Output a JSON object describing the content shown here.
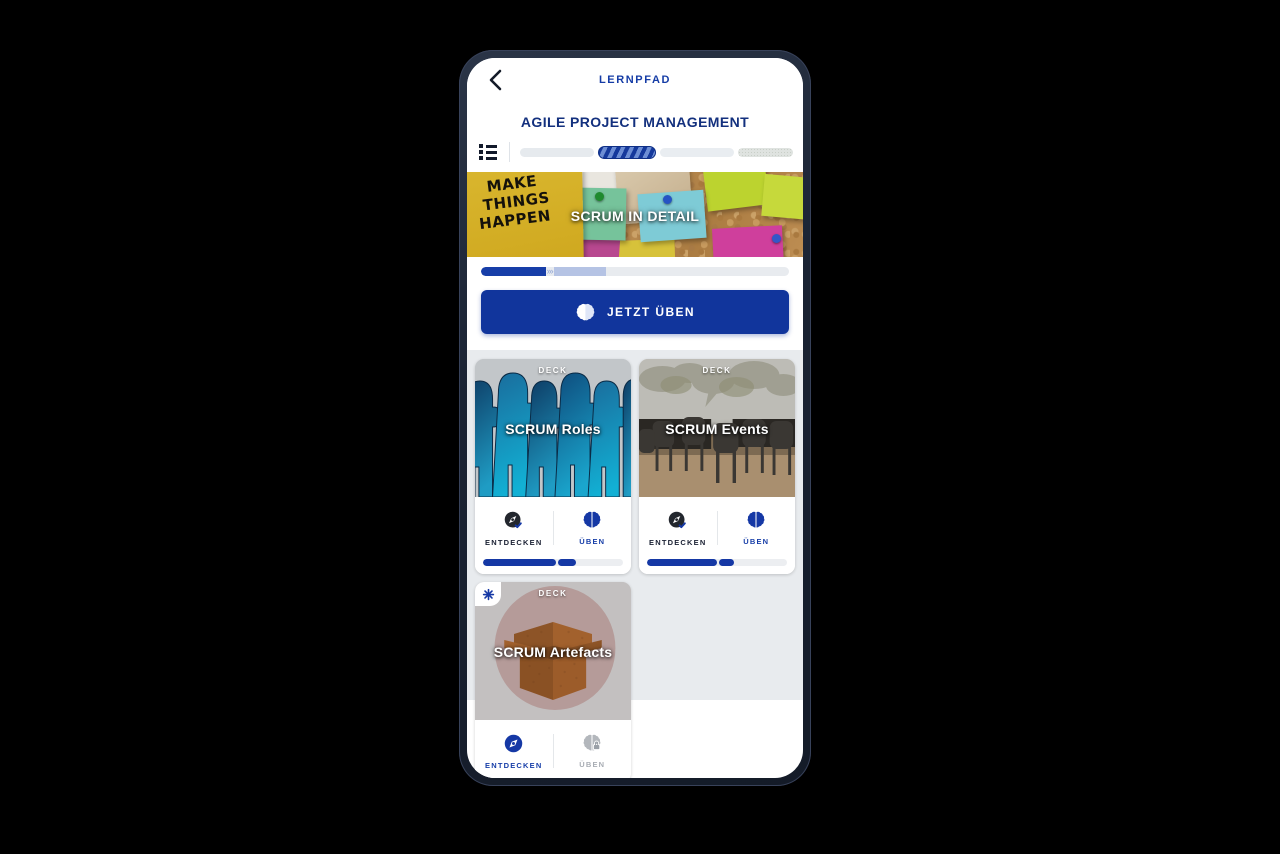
{
  "app": {
    "header": {
      "back_icon": "chevron-left-icon",
      "title": "LERNPFAD",
      "course_title": "AGILE PROJECT MANAGEMENT"
    },
    "path_bar": {
      "list_icon": "list-view-icon",
      "segments": [
        {
          "state": "done",
          "label": ""
        },
        {
          "state": "active",
          "label": ""
        },
        {
          "state": "next",
          "label": ""
        },
        {
          "state": "locked",
          "label": ""
        }
      ]
    },
    "hero": {
      "label": "SCRUM IN DETAIL",
      "sticky_note_text": [
        "MAKE",
        "THINGS",
        "HAPPEN"
      ],
      "image_description": "corkboard-with-sticky-notes"
    },
    "lesson": {
      "progress_percent": 21,
      "progress_secondary_percent": 17,
      "chevrons": "›››",
      "cta_label": "JETZT ÜBEN",
      "cta_icon": "brain-icon",
      "cta_color": "#11359c"
    },
    "decks": [
      {
        "kind": "DECK",
        "name": "SCRUM Roles",
        "art": "puzzle-people",
        "badge": null,
        "actions": {
          "explore": {
            "label": "ENTDECKEN",
            "icon": "compass-check-icon",
            "state": "completed"
          },
          "practice": {
            "label": "ÜBEN",
            "icon": "brain-icon",
            "state": "available"
          }
        },
        "progress": {
          "primary_percent": 52,
          "secondary_percent": 13
        }
      },
      {
        "kind": "DECK",
        "name": "SCRUM Events",
        "art": "meeting-room",
        "badge": null,
        "actions": {
          "explore": {
            "label": "ENTDECKEN",
            "icon": "compass-check-icon",
            "state": "completed"
          },
          "practice": {
            "label": "ÜBEN",
            "icon": "brain-icon",
            "state": "available"
          }
        },
        "progress": {
          "primary_percent": 50,
          "secondary_percent": 11
        }
      },
      {
        "kind": "DECK",
        "name": "SCRUM Artefacts",
        "art": "cardboard-box",
        "badge": {
          "icon": "asterisk-star-icon",
          "color": "#1538a5"
        },
        "actions": {
          "explore": {
            "label": "ENTDECKEN",
            "icon": "compass-icon",
            "state": "available"
          },
          "practice": {
            "label": "ÜBEN",
            "icon": "brain-lock-icon",
            "state": "locked"
          }
        },
        "progress": null
      }
    ],
    "colors": {
      "brand_blue": "#11359c",
      "header_blue": "#153ca6",
      "title_blue": "#13307e",
      "deck_bg": "#e8ebee",
      "phone_frame": "#1a2333"
    }
  }
}
